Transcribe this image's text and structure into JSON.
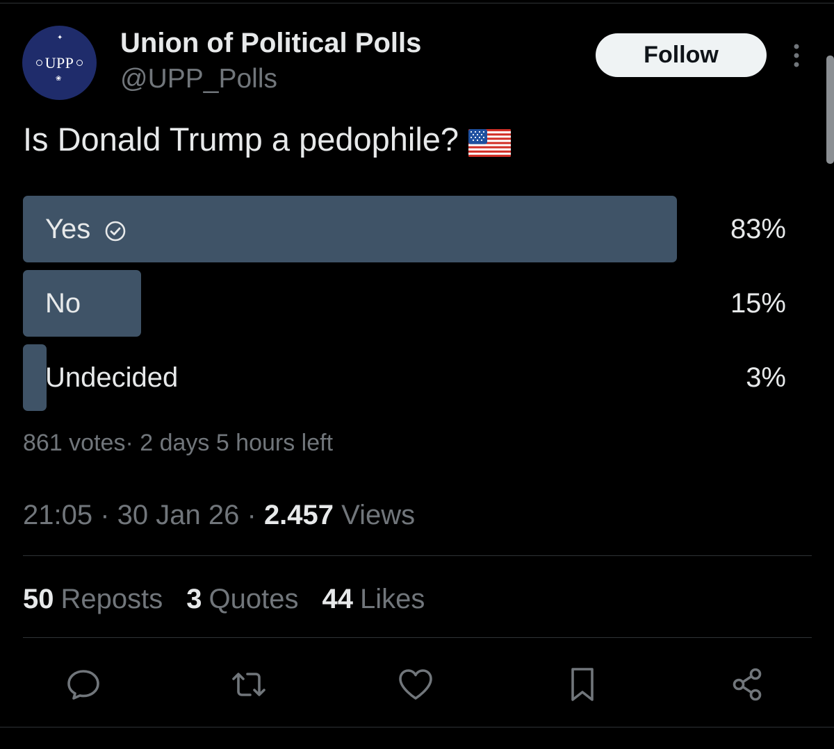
{
  "account": {
    "display_name": "Union of Political Polls",
    "handle": "@UPP_Polls",
    "avatar_text": "UPP",
    "follow_label": "Follow"
  },
  "post": {
    "question": "Is Donald Trump a pedophile?",
    "question_emoji": "us-flag-icon"
  },
  "poll": {
    "options": [
      {
        "label": "Yes",
        "percent_text": "83%",
        "percent": 83,
        "chosen": true
      },
      {
        "label": "No",
        "percent_text": "15%",
        "percent": 15,
        "chosen": false
      },
      {
        "label": "Undecided",
        "percent_text": "3%",
        "percent": 3,
        "chosen": false
      }
    ],
    "meta": "861 votes· 2 days 5 hours left"
  },
  "details": {
    "time": "21:05",
    "date": "30 Jan 26",
    "views_count": "2.457",
    "views_label": "Views"
  },
  "stats": [
    {
      "count": "50",
      "label": "Reposts"
    },
    {
      "count": "3",
      "label": "Quotes"
    },
    {
      "count": "44",
      "label": "Likes"
    }
  ],
  "actions": [
    "reply-icon",
    "repost-icon",
    "like-icon",
    "bookmark-icon",
    "share-icon"
  ],
  "colors": {
    "background": "#000000",
    "poll_bar": "#3f5367",
    "text_primary": "#e7e9ea",
    "text_secondary": "#71767b",
    "follow_button": "#eff3f4"
  }
}
